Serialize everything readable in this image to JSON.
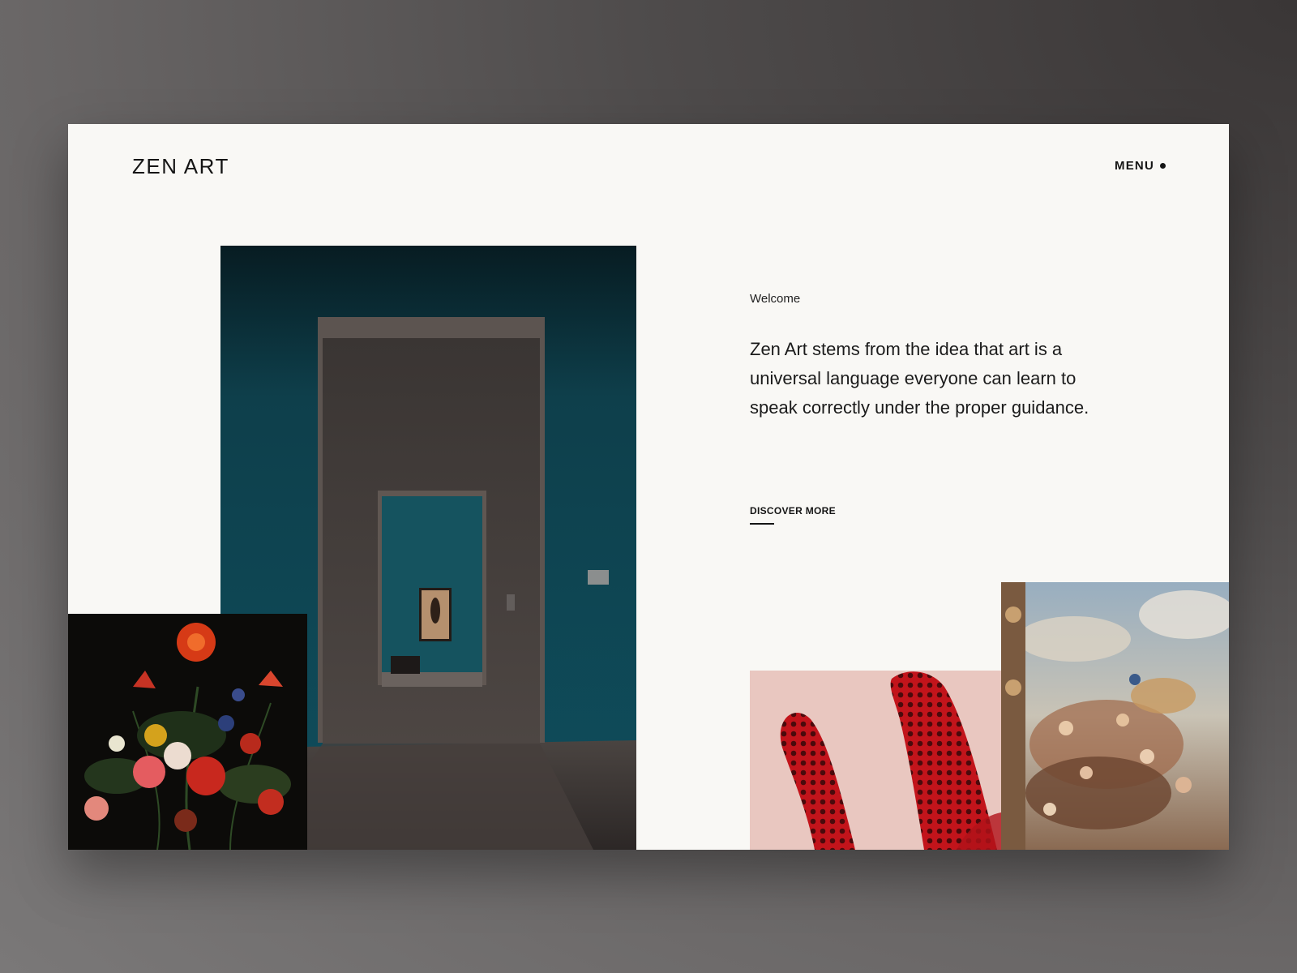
{
  "header": {
    "logo": "ZEN ART",
    "menu_label": "MENU"
  },
  "intro": {
    "eyebrow": "Welcome",
    "lead": "Zen Art stems from the idea that art is a universal language everyone can learn to speak correctly under the proper guidance.",
    "cta_label": "DISCOVER MORE"
  },
  "images": {
    "gallery": "museum-gallery-photo",
    "flowers": "still-life-flowers-painting",
    "coral": "red-polka-dot-sculpture-photo",
    "ceiling": "baroque-ceiling-fresco"
  },
  "colors": {
    "page_bg": "#f9f8f5",
    "text": "#151515",
    "gallery_teal": "#0f4a58"
  }
}
